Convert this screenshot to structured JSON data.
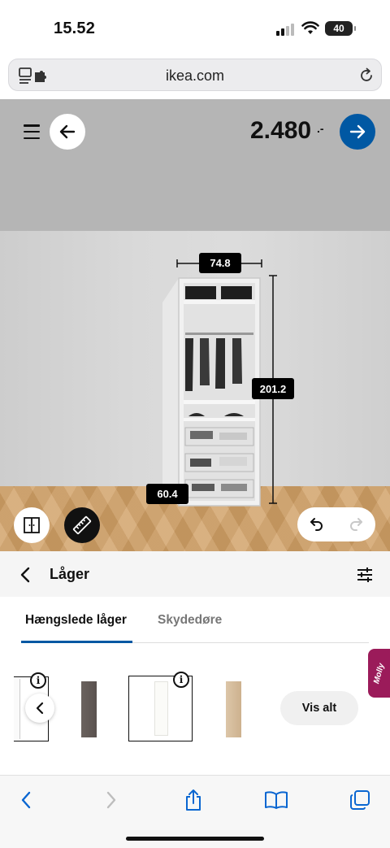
{
  "status_bar": {
    "time": "15.52",
    "battery_level": "40"
  },
  "address_bar": {
    "url": "ikea.com"
  },
  "planner": {
    "price": "2.480",
    "price_suffix": ".-",
    "dimensions": {
      "width": "74.8",
      "height": "201.2",
      "depth": "60.4"
    }
  },
  "panel": {
    "title": "Låger",
    "tabs": [
      {
        "label": "Hængslede låger",
        "active": true
      },
      {
        "label": "Skydedøre",
        "active": false
      }
    ],
    "info_glyph": "i",
    "see_all_label": "Vis alt",
    "assistant_label": "Molly",
    "door_swatches": [
      "white",
      "dark-grey",
      "white",
      "light-oak"
    ]
  },
  "colors": {
    "ikea_blue": "#0058a3",
    "assistant_pink": "#9b1b5a",
    "ceiling_grey": "#b5b5b5",
    "floor_wood": "#d2a36a"
  }
}
